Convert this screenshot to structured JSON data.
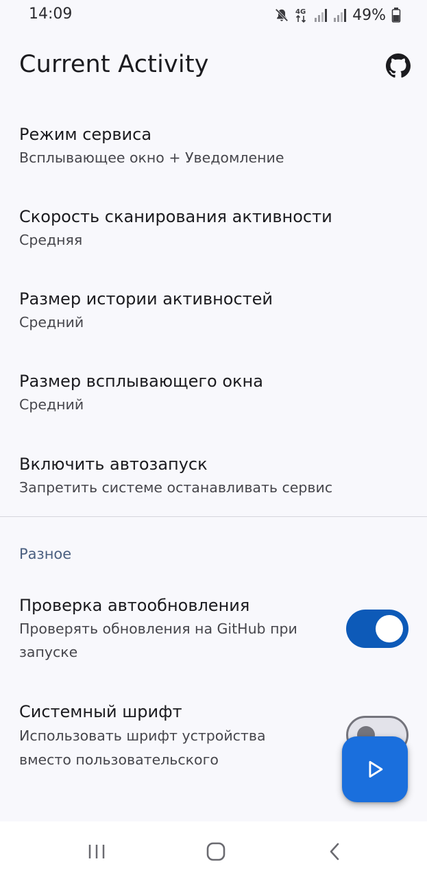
{
  "status_bar": {
    "time": "14:09",
    "network": "4G",
    "battery": "49%"
  },
  "app": {
    "title": "Current Activity",
    "header_icon": "github-icon"
  },
  "preferences": [
    {
      "title": "Режим сервиса",
      "summary": "Всплывающее окно + Уведомление"
    },
    {
      "title": "Скорость сканирования активности",
      "summary": "Средняя"
    },
    {
      "title": "Размер истории активностей",
      "summary": "Средний"
    },
    {
      "title": "Размер всплывающего окна",
      "summary": "Средний"
    },
    {
      "title": "Включить автозапуск",
      "summary": "Запретить системе останавливать сервис"
    }
  ],
  "misc": {
    "category": "Разное",
    "auto_update": {
      "title": "Проверка автообновления",
      "summary_line1": "Проверять обновления на GitHub при",
      "summary_line2": "запуске",
      "enabled": true
    },
    "system_font": {
      "title": "Системный шрифт",
      "summary_line1": "Использовать шрифт устройства",
      "summary_line2": "вместо пользовательского",
      "enabled": false
    }
  },
  "fab": {
    "icon": "play-icon"
  },
  "colors": {
    "accent": "#1a6fdd",
    "switch_on": "#0d5ab8",
    "category": "#4a5f80",
    "background": "#f8f8fc"
  }
}
